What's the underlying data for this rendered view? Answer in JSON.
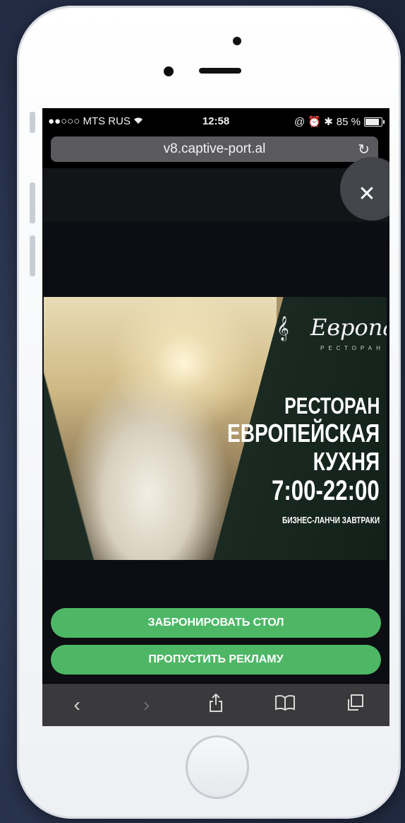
{
  "status_bar": {
    "carrier": "●●○○○ MTS RUS",
    "wifi": "wifi-icon",
    "time": "12:58",
    "right_icons": "@ ⏰ ✱",
    "battery_percent": "85 %",
    "battery_level": 0.85
  },
  "browser": {
    "url": "v8.captive-port.al",
    "reload_icon": "reload-icon"
  },
  "ad": {
    "brand": "Европа",
    "brand_sub": "РЕСТОРАН",
    "line1": "РЕСТОРАН",
    "line2": "ЕВРОПЕЙСКАЯ",
    "line3": "КУХНЯ",
    "line4": "7:00-22:00",
    "line5": "БИЗНЕС-ЛАНЧИ ЗАВТРАКИ"
  },
  "buttons": {
    "book_table": "ЗАБРОНИРОВАТЬ СТОЛ",
    "skip_ad": "ПРОПУСТИТЬ РЕКЛАМУ"
  },
  "toolbar": {
    "back": "‹",
    "forward": "›",
    "share": "⇪",
    "bookmarks": "📖",
    "tabs": "⧉"
  },
  "colors": {
    "accent_green": "#4eb766",
    "toolbar_bg": "#3a3a3c"
  }
}
